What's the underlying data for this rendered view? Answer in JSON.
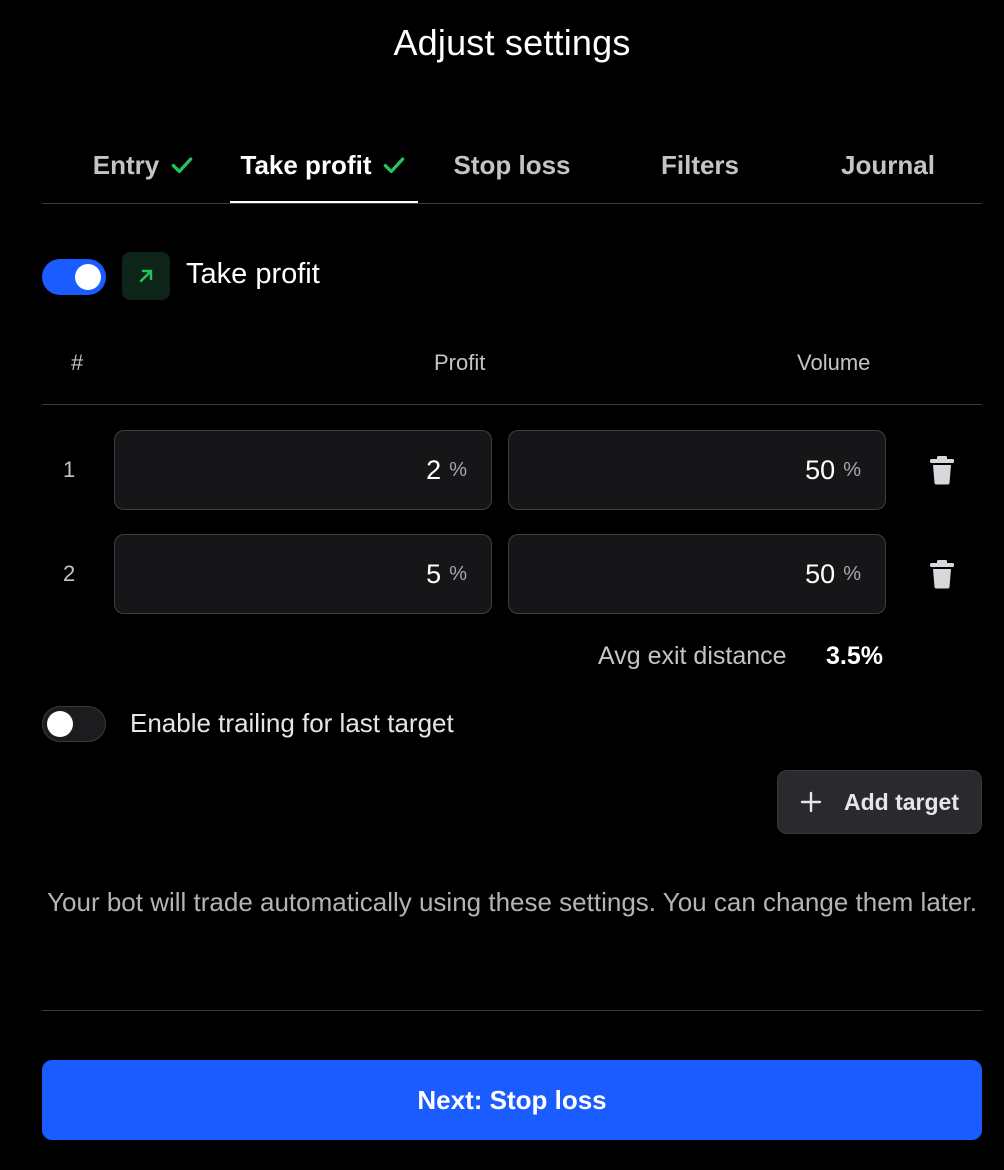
{
  "title": "Adjust settings",
  "tabs": [
    {
      "label": "Entry",
      "completed": true,
      "active": false
    },
    {
      "label": "Take profit",
      "completed": true,
      "active": true
    },
    {
      "label": "Stop loss",
      "completed": false,
      "active": false
    },
    {
      "label": "Filters",
      "completed": false,
      "active": false
    },
    {
      "label": "Journal",
      "completed": false,
      "active": false
    }
  ],
  "take_profit": {
    "enabled": true,
    "icon": "arrow-up-right-icon",
    "label": "Take profit"
  },
  "table": {
    "headers": {
      "num": "#",
      "profit": "Profit",
      "volume": "Volume"
    },
    "rows": [
      {
        "num": "1",
        "profit": "2",
        "profit_unit": "%",
        "volume": "50",
        "volume_unit": "%"
      },
      {
        "num": "2",
        "profit": "5",
        "profit_unit": "%",
        "volume": "50",
        "volume_unit": "%"
      }
    ]
  },
  "avg_exit": {
    "label": "Avg exit distance",
    "value": "3.5%"
  },
  "trailing": {
    "enabled": false,
    "label": "Enable trailing for last target"
  },
  "add_target": {
    "label": "Add target"
  },
  "note": "Your bot will trade automatically using these settings. You can change them later.",
  "next_button": {
    "label": "Next: Stop loss"
  },
  "colors": {
    "accent": "#1a5cff",
    "check": "#22c55e",
    "background": "#000000"
  }
}
